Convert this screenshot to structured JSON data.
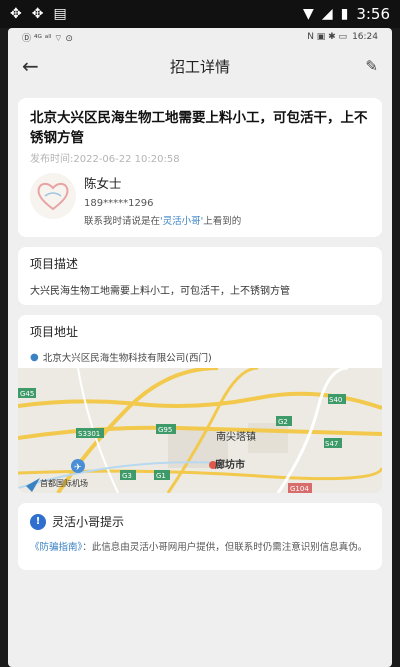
{
  "os_status": {
    "time": "3:56"
  },
  "inner_status": {
    "time": "16:24",
    "left_indicators": "Ⓓ ⁴ᴳ ᵃˡˡ ⌔ ⊙",
    "right_indicators": "N ▣ ✱ ▭"
  },
  "header": {
    "title": "招工详情"
  },
  "job": {
    "title": "北京大兴区民海生物工地需要上料小工，可包活干，上不锈钢方管",
    "time": "发布时间:2022-06-22 10:20:58",
    "contact_name": "陈女士",
    "phone": "189*****1296",
    "tip_prefix": "联系我时请说是在",
    "tip_link": "'灵活小哥'",
    "tip_suffix": "上看到的"
  },
  "description": {
    "title": "项目描述",
    "body": "大兴民海生物工地需要上料小工，可包活干，上不锈钢方管"
  },
  "address": {
    "title": "项目地址",
    "line": "北京大兴区民海生物科技有限公司(西门)",
    "map_labels": {
      "nanjian": "南尖塔镇",
      "langfang": "廊坊市",
      "airport": "首都国际机场",
      "g95": "G95",
      "g3": "G3",
      "g2": "G2",
      "s40": "S40",
      "s47": "S47",
      "s3301": "S3301",
      "g104": "G104",
      "g45": "G45",
      "g1": "G1"
    }
  },
  "notice": {
    "title": "灵活小哥提示",
    "link": "《防骗指南》",
    "body": "：此信息由灵活小哥网用户提供，但联系时仍需注意识别信息真伪。"
  },
  "colors": {
    "accent": "#3b82c4",
    "info": "#2f6fcf"
  }
}
